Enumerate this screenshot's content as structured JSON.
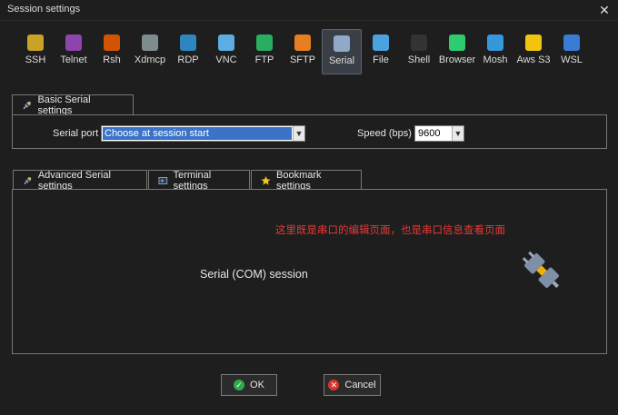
{
  "window": {
    "title": "Session settings",
    "close_glyph": "✕"
  },
  "protocols": [
    {
      "label": "SSH",
      "icon": "ssh-icon",
      "color": "#c9a227"
    },
    {
      "label": "Telnet",
      "icon": "telnet-icon",
      "color": "#8e44ad"
    },
    {
      "label": "Rsh",
      "icon": "rsh-icon",
      "color": "#d35400"
    },
    {
      "label": "Xdmcp",
      "icon": "xdmcp-icon",
      "color": "#7f8c8d"
    },
    {
      "label": "RDP",
      "icon": "rdp-icon",
      "color": "#2e86c1"
    },
    {
      "label": "VNC",
      "icon": "vnc-icon",
      "color": "#5dade2"
    },
    {
      "label": "FTP",
      "icon": "ftp-icon",
      "color": "#27ae60"
    },
    {
      "label": "SFTP",
      "icon": "sftp-icon",
      "color": "#e67e22"
    },
    {
      "label": "Serial",
      "icon": "serial-icon",
      "color": "#8fa9c9"
    },
    {
      "label": "File",
      "icon": "file-icon",
      "color": "#4aa3df"
    },
    {
      "label": "Shell",
      "icon": "shell-icon",
      "color": "#333333"
    },
    {
      "label": "Browser",
      "icon": "browser-icon",
      "color": "#2ecc71"
    },
    {
      "label": "Mosh",
      "icon": "mosh-icon",
      "color": "#3498db"
    },
    {
      "label": "Aws S3",
      "icon": "aws-s3-icon",
      "color": "#f1c40f"
    },
    {
      "label": "WSL",
      "icon": "wsl-icon",
      "color": "#3a7bd5"
    }
  ],
  "basic": {
    "tab_label": "Basic Serial settings",
    "serial_port_label": "Serial port *",
    "serial_port_value": "Choose at session start",
    "speed_label": "Speed (bps) *",
    "speed_value": "9600"
  },
  "tabs": {
    "advanced": "Advanced Serial settings",
    "terminal": "Terminal settings",
    "bookmark": "Bookmark settings"
  },
  "main": {
    "annotation": "这里既是串口的编辑页面，也是串口信息查看页面",
    "annotation_color": "#e53935",
    "session_label": "Serial (COM) session"
  },
  "buttons": {
    "ok": "OK",
    "cancel": "Cancel"
  }
}
